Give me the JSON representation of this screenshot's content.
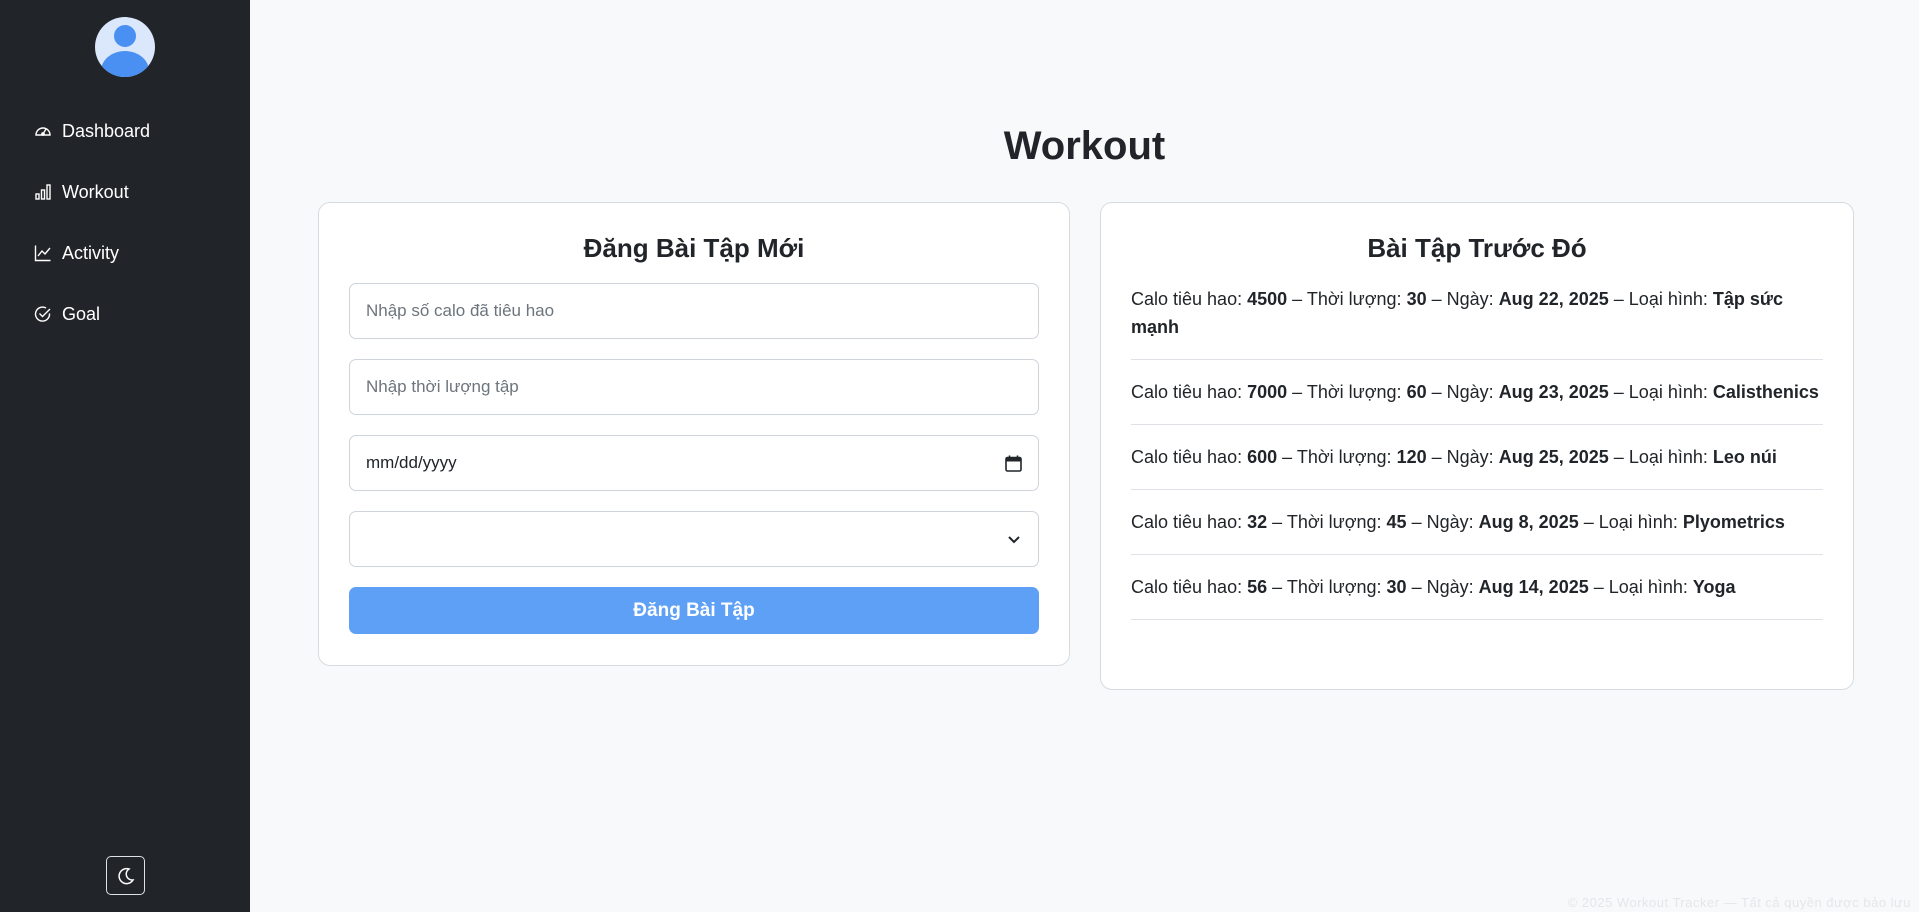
{
  "sidebar": {
    "items": [
      {
        "label": "Dashboard",
        "icon": "dashboard-gauge-icon"
      },
      {
        "label": "Workout",
        "icon": "bar-chart-icon"
      },
      {
        "label": "Activity",
        "icon": "line-chart-icon"
      },
      {
        "label": "Goal",
        "icon": "check-circle-icon"
      }
    ],
    "theme_toggle_icon": "moon-icon"
  },
  "page": {
    "title": "Workout"
  },
  "form": {
    "title": "Đăng Bài Tập Mới",
    "calories_placeholder": "Nhập số calo đã tiêu hao",
    "duration_placeholder": "Nhập thời lượng tập",
    "date_placeholder": "mm/dd/yyyy",
    "type_selected": "",
    "submit_label": "Đăng Bài Tập"
  },
  "history": {
    "title": "Bài Tập Trước Đó",
    "labels": {
      "calories": "Calo tiêu hao:",
      "duration": "Thời lượng:",
      "date": "Ngày:",
      "type": "Loại hình:",
      "separator": "–"
    },
    "items": [
      {
        "calories": "4500",
        "duration": "30",
        "date": "Aug 22, 2025",
        "type": "Tập sức mạnh"
      },
      {
        "calories": "7000",
        "duration": "60",
        "date": "Aug 23, 2025",
        "type": "Calisthenics"
      },
      {
        "calories": "600",
        "duration": "120",
        "date": "Aug 25, 2025",
        "type": "Leo núi"
      },
      {
        "calories": "32",
        "duration": "45",
        "date": "Aug 8, 2025",
        "type": "Plyometrics"
      },
      {
        "calories": "56",
        "duration": "30",
        "date": "Aug 14, 2025",
        "type": "Yoga"
      }
    ]
  },
  "colors": {
    "sidebar_bg": "#212529",
    "page_bg": "#f8f9fa",
    "primary_button": "#5fa0f7",
    "avatar_accent": "#4a90f2"
  },
  "footer": {
    "text": "© 2025 Workout Tracker — Tất cả quyền được bảo lưu"
  }
}
